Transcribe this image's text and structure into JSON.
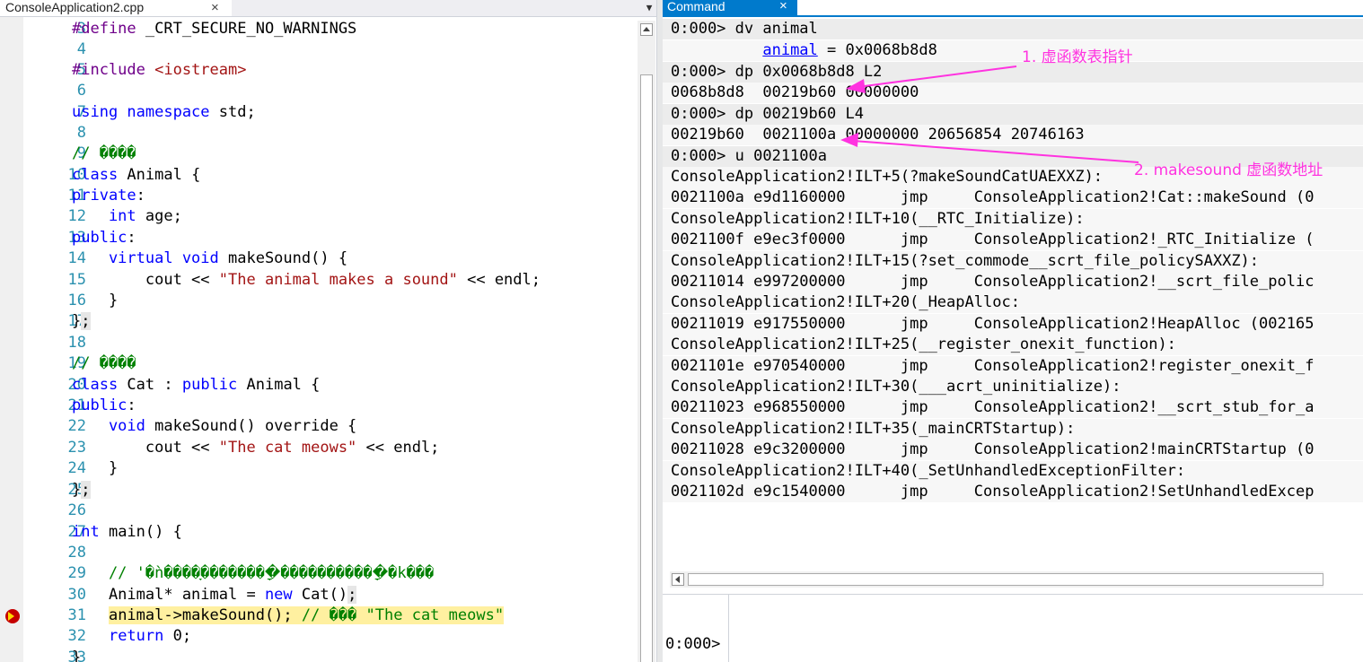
{
  "editor": {
    "tab_title": "ConsoleApplication2.cpp",
    "tab_close": "×",
    "tab_dropdown": "▼",
    "lines": [
      {
        "n": "3"
      },
      {
        "n": "4"
      },
      {
        "n": "5"
      },
      {
        "n": "6"
      },
      {
        "n": "7"
      },
      {
        "n": "8"
      },
      {
        "n": "9"
      },
      {
        "n": "10"
      },
      {
        "n": "11"
      },
      {
        "n": "12"
      },
      {
        "n": "13"
      },
      {
        "n": "14"
      },
      {
        "n": "15"
      },
      {
        "n": "16"
      },
      {
        "n": "17"
      },
      {
        "n": "18"
      },
      {
        "n": "19"
      },
      {
        "n": "20"
      },
      {
        "n": "21"
      },
      {
        "n": "22"
      },
      {
        "n": "23"
      },
      {
        "n": "24"
      },
      {
        "n": "25"
      },
      {
        "n": "26"
      },
      {
        "n": "27"
      },
      {
        "n": "28"
      },
      {
        "n": "29"
      },
      {
        "n": "30"
      },
      {
        "n": "31"
      },
      {
        "n": "32"
      },
      {
        "n": "33"
      }
    ],
    "tokens": {
      "define_kw": "#define",
      "define_rest": " _CRT_SECURE_NO_WARNINGS",
      "include_kw": "#include",
      "include_rest": " <iostream>",
      "using_kw": "using namespace",
      "using_rest": " std;",
      "comment_animal": "// ����",
      "class_kw": "class",
      "animal_decl": " Animal {",
      "private_kw": "private",
      "colon": ":",
      "int_kw": "    int",
      "age_rest": " age;",
      "public_kw": "public",
      "virtual_kw": "    virtual void",
      "makesound_decl": " makeSound() {",
      "cout_prefix": "        cout << ",
      "animal_string": "\"The animal makes a sound\"",
      "endl_rest": " << endl;",
      "close_brace_indent": "    }",
      "close_brace": "}",
      "semicolon": ";",
      "comment_cat": "// ����",
      "cat_decl_1": " Cat : ",
      "public_kw2": "public",
      "cat_decl_2": " Animal {",
      "void_kw": "    void",
      "override_decl": " makeSound() override {",
      "cat_string": "\"The cat meows\"",
      "main_int": "int",
      "main_rest": " main() {",
      "comment_long": "    // '�ǹ����ָ��������ָ�����������ָ�k���",
      "animal_ptr_1": "    Animal* animal = ",
      "new_kw": "new",
      "animal_ptr_2": " Cat()",
      "call_line": "animal->makeSound();",
      "call_comment": " // ��� \"The cat meows\"",
      "indent4": "    ",
      "return_kw": "return",
      "return_rest": " 0;"
    }
  },
  "command": {
    "tab_title": "Command",
    "tab_close": "×",
    "prompt": "0:000>",
    "output": {
      "l1": "0:000> dv animal",
      "l2_name": "animal",
      "l2_rest": " = 0x0068b8d8",
      "l3": "0:000> dp 0x0068b8d8 L2",
      "l4": "0068b8d8  00219b60 00000000",
      "l5": "0:000> dp 00219b60 L4",
      "l6": "00219b60  0021100a 00000000 20656854 20746163",
      "l7": "0:000> u 0021100a",
      "l8": "ConsoleApplication2!ILT+5(?makeSoundCatUAEXXZ):",
      "l9": "0021100a e9d1160000      jmp     ConsoleApplication2!Cat::makeSound (0",
      "l10": "ConsoleApplication2!ILT+10(__RTC_Initialize):",
      "l11": "0021100f e9ec3f0000      jmp     ConsoleApplication2!_RTC_Initialize (",
      "l12": "ConsoleApplication2!ILT+15(?set_commode__scrt_file_policySAXXZ):",
      "l13": "00211014 e997200000      jmp     ConsoleApplication2!__scrt_file_polic",
      "l14": "ConsoleApplication2!ILT+20(_HeapAlloc:",
      "l15": "00211019 e917550000      jmp     ConsoleApplication2!HeapAlloc (002165",
      "l16": "ConsoleApplication2!ILT+25(__register_onexit_function):",
      "l17": "0021101e e970540000      jmp     ConsoleApplication2!register_onexit_f",
      "l18": "ConsoleApplication2!ILT+30(___acrt_uninitialize):",
      "l19": "00211023 e968550000      jmp     ConsoleApplication2!__scrt_stub_for_a",
      "l20": "ConsoleApplication2!ILT+35(_mainCRTStartup):",
      "l21": "00211028 e9c3200000      jmp     ConsoleApplication2!mainCRTStartup (0",
      "l22": "ConsoleApplication2!ILT+40(_SetUnhandledExceptionFilter:",
      "l23": "0021102d e9c1540000      jmp     ConsoleApplication2!SetUnhandledExcep"
    }
  },
  "annotations": {
    "a1": "1. 虚函数表指针",
    "a2": "2. makesound 虚函数地址",
    "color": "#ff33e0"
  }
}
